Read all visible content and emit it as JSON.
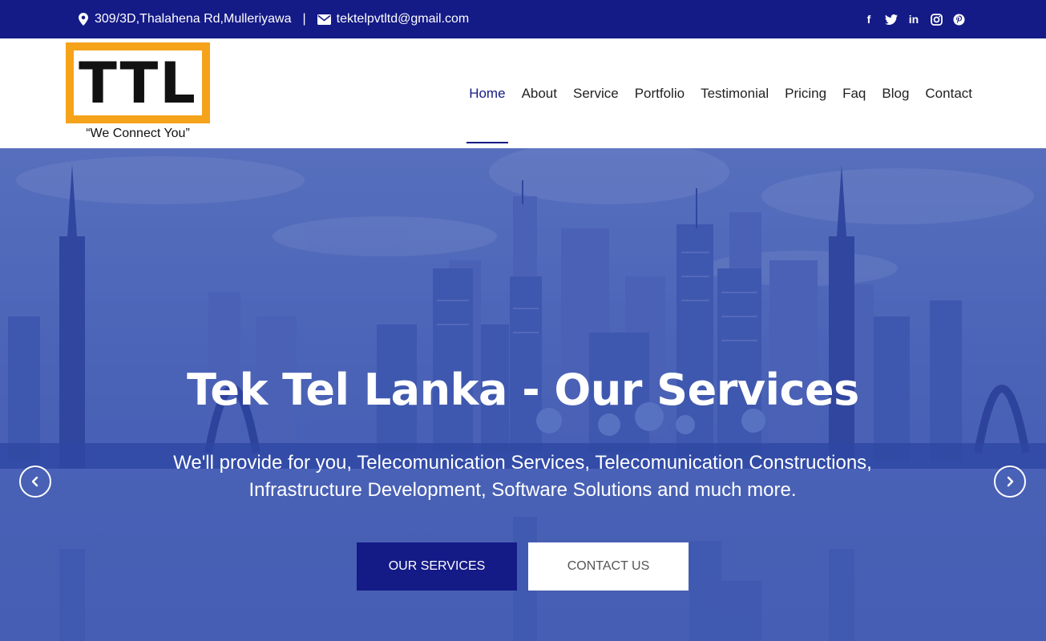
{
  "topbar": {
    "address": "309/3D,Thalahena Rd,Mulleriyawa",
    "separator": "|",
    "email": "tektelpvtltd@gmail.com",
    "address_icon": "map-marker-icon",
    "email_icon": "envelope-icon",
    "social": [
      {
        "name": "facebook-icon",
        "glyph": "f"
      },
      {
        "name": "twitter-icon",
        "glyph": "t"
      },
      {
        "name": "linkedin-icon",
        "glyph": "in"
      },
      {
        "name": "instagram-icon",
        "glyph": "◎"
      },
      {
        "name": "pinterest-icon",
        "glyph": "p"
      }
    ],
    "bg_color": "#141a86"
  },
  "header": {
    "logo_text": "TTL",
    "logo_tagline": "“We Connect You”",
    "logo_border_color": "#f5a31a",
    "nav": [
      {
        "label": "Home",
        "active": true
      },
      {
        "label": "About"
      },
      {
        "label": "Service"
      },
      {
        "label": "Portfolio"
      },
      {
        "label": "Testimonial"
      },
      {
        "label": "Pricing"
      },
      {
        "label": "Faq"
      },
      {
        "label": "Blog"
      },
      {
        "label": "Contact"
      }
    ]
  },
  "hero": {
    "title": "Tek Tel Lanka - Our Services",
    "subtitle_line1": "We'll provide for you, Telecomunication Services, Telecomunication Constructions,",
    "subtitle_line2": "Infrastructure Development, Software Solutions and much more.",
    "primary_button": "OUR SERVICES",
    "secondary_button": "CONTACT US",
    "prev_icon": "chevron-left-icon",
    "next_icon": "chevron-right-icon"
  }
}
